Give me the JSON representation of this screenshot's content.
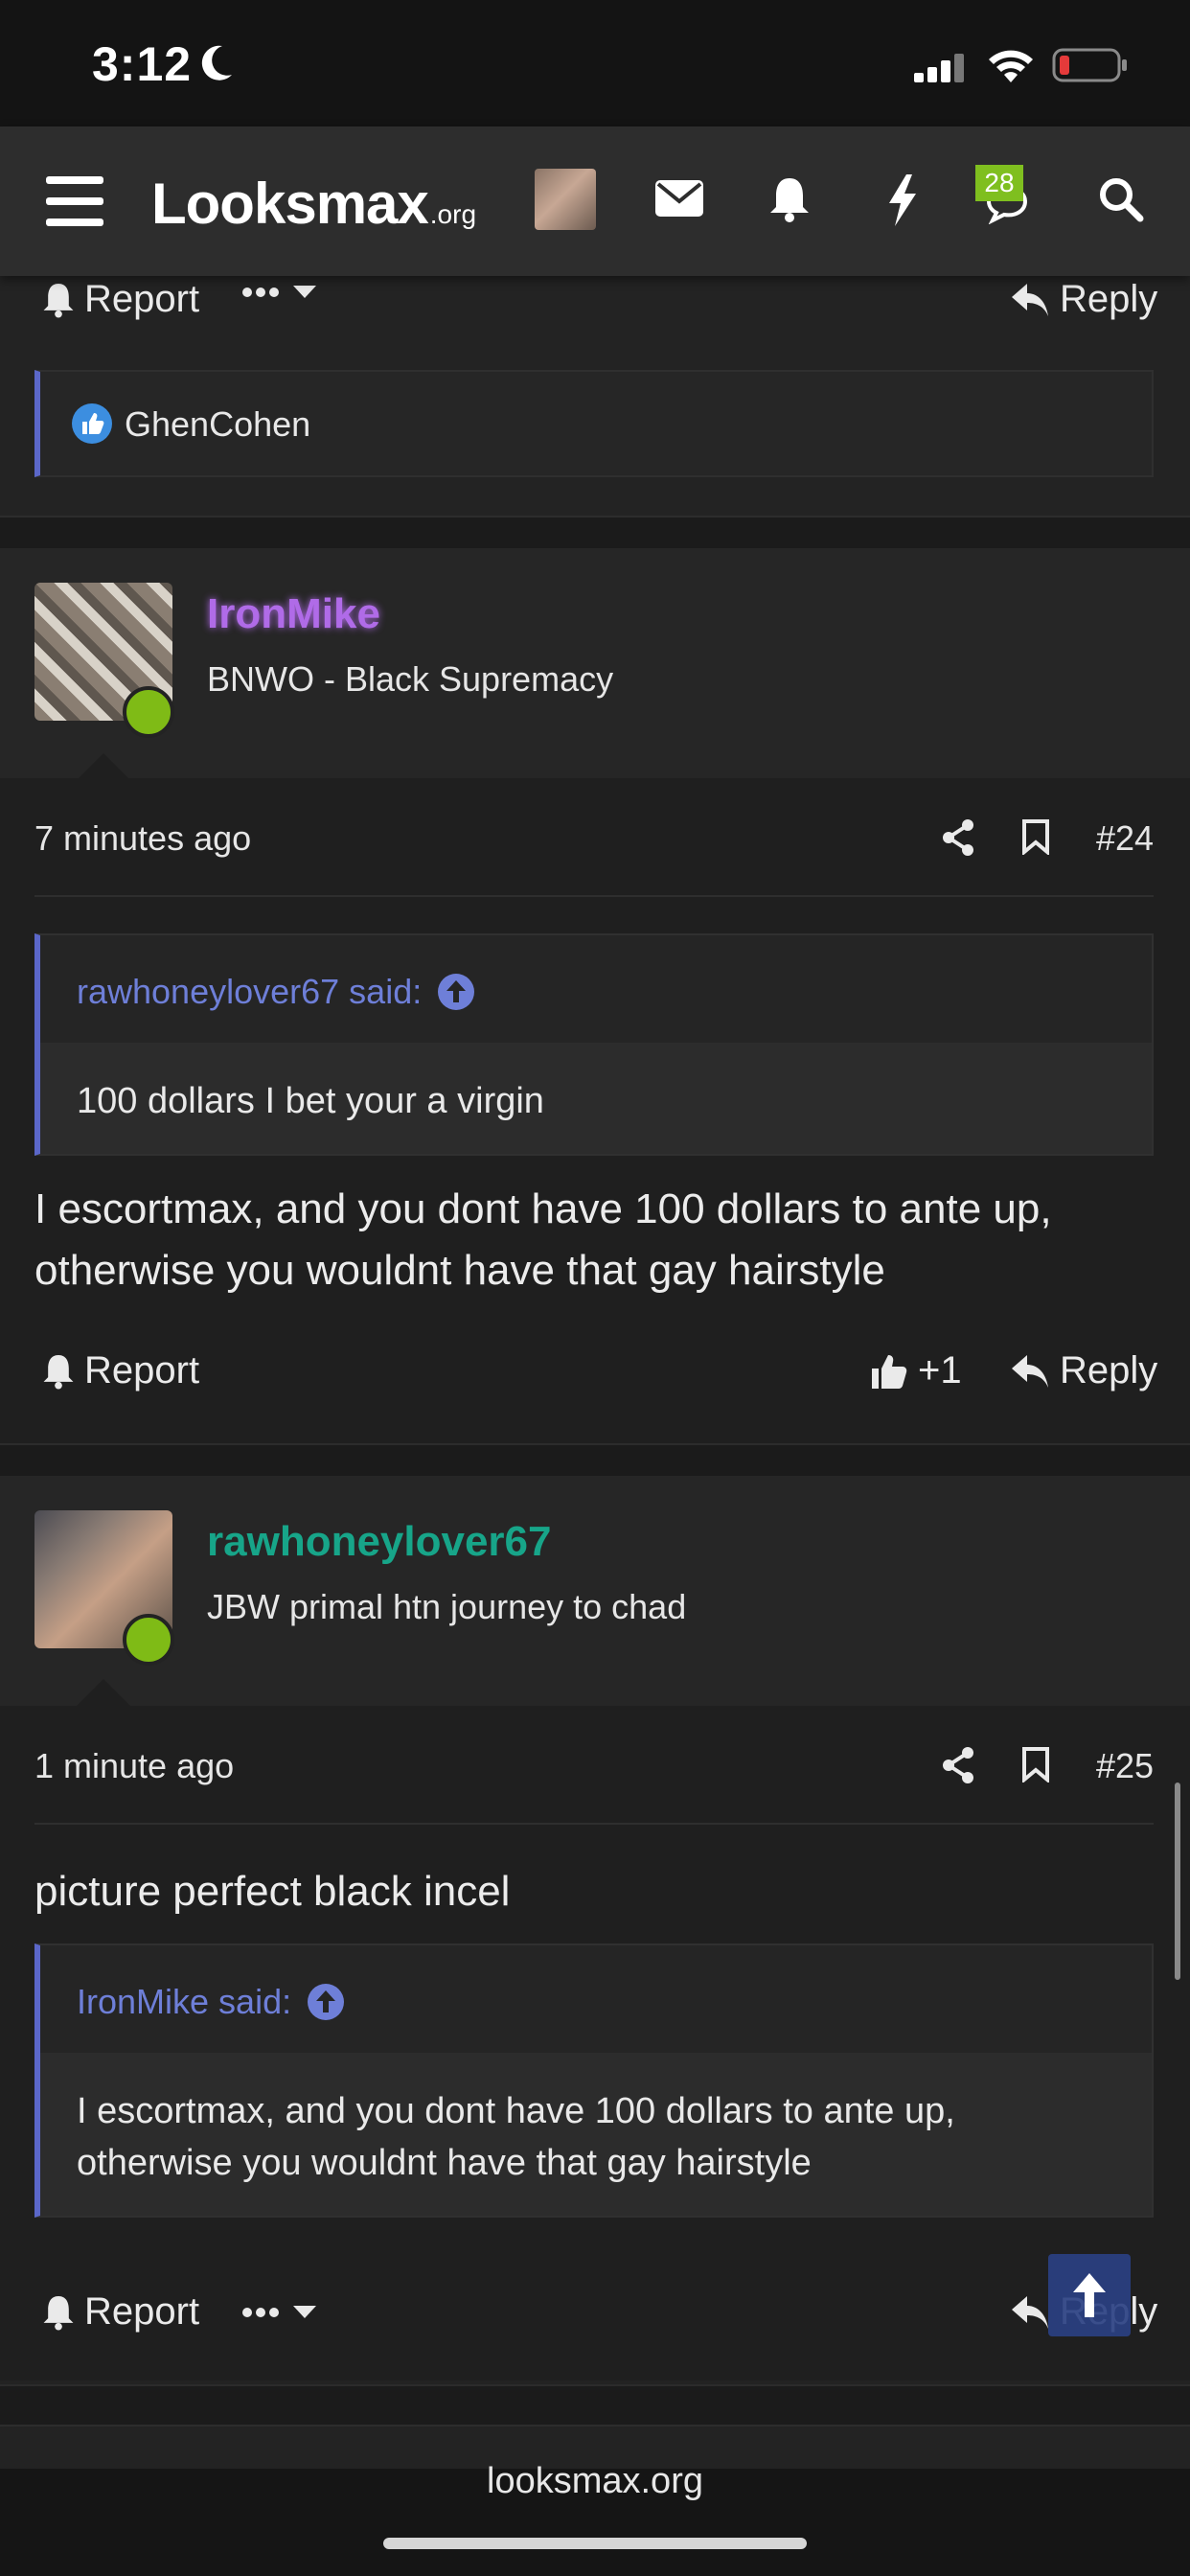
{
  "status_bar": {
    "time": "3:12"
  },
  "nav": {
    "logo_main": "Looksmax",
    "logo_suffix": ".org",
    "conversations_badge": "28"
  },
  "prev_post": {
    "report_label": "Report",
    "reply_label": "Reply",
    "reaction_user": "GhenCohen"
  },
  "posts": [
    {
      "username": "IronMike",
      "user_title": "BNWO - Black Supremacy",
      "time": "7 minutes ago",
      "post_number": "#24",
      "quote_author": "rawhoneylover67 said:",
      "quote_text": "100 dollars I bet your a virgin",
      "message": "I escortmax, and you dont have 100 dollars to ante up, otherwise you wouldnt have that gay hairstyle",
      "report_label": "Report",
      "like_count": "+1",
      "reply_label": "Reply"
    },
    {
      "username": "rawhoneylover67",
      "user_title": "JBW primal htn journey to chad",
      "time": "1 minute ago",
      "post_number": "#25",
      "message": "picture perfect black incel",
      "quote_author": "IronMike said:",
      "quote_text": "I escortmax, and you dont have 100 dollars to ante up, otherwise you wouldnt have that gay hairstyle",
      "report_label": "Report",
      "reply_label": "Reply"
    }
  ],
  "footer": {
    "domain": "looksmax.org"
  },
  "colors": {
    "accent_blue": "#5b67c9",
    "ironmike_name": "#b06be8",
    "rawhoney_name": "#17a589",
    "online": "#7fbb16"
  }
}
